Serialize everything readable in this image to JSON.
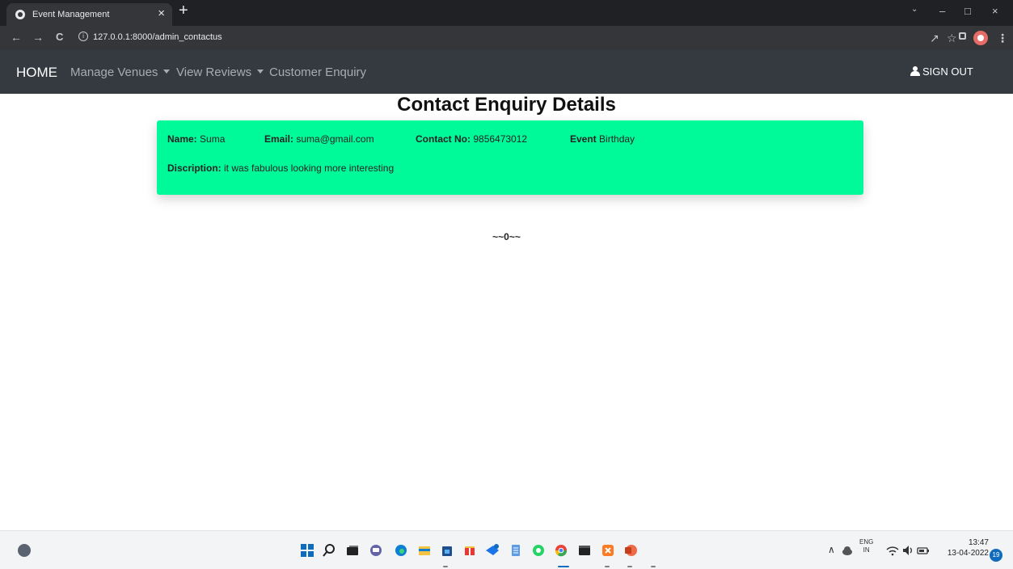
{
  "browser": {
    "tab_title": "Event Management",
    "tab_close": "×",
    "new_tab": "+",
    "url": "127.0.0.1:8000/admin_contactus",
    "minimize": "–",
    "maximize": "□",
    "close": "×",
    "back": "←",
    "forward": "→",
    "reload": "C",
    "info": "i",
    "share_icon": "↗",
    "star": "☆",
    "menu": "⋮"
  },
  "nav": {
    "brand": "HOME",
    "links": [
      {
        "label": "Manage Venues"
      },
      {
        "label": "View Reviews"
      },
      {
        "label": "Customer Enquiry"
      }
    ],
    "signout": "SIGN OUT"
  },
  "page": {
    "title": "Contact Enquiry Details",
    "separator": "~~0~~"
  },
  "enquiry": {
    "name_label": "Name:",
    "name": "Suma",
    "email_label": "Email:",
    "email": "suma@gmail.com",
    "contact_label": "Contact No:",
    "contact": "9856473012",
    "event_label": "Event",
    "event": "Birthday",
    "description_label": "Discription:",
    "description": "it was fabulous looking more interesting"
  },
  "taskbar": {
    "language": "ENG",
    "region": "IN",
    "time": "13:47",
    "date": "13-04-2022",
    "notification_count": "19",
    "tray_up": "∧"
  },
  "colors": {
    "navbar": "#343a40",
    "card": "#00fa9a",
    "browser": "#202124"
  }
}
